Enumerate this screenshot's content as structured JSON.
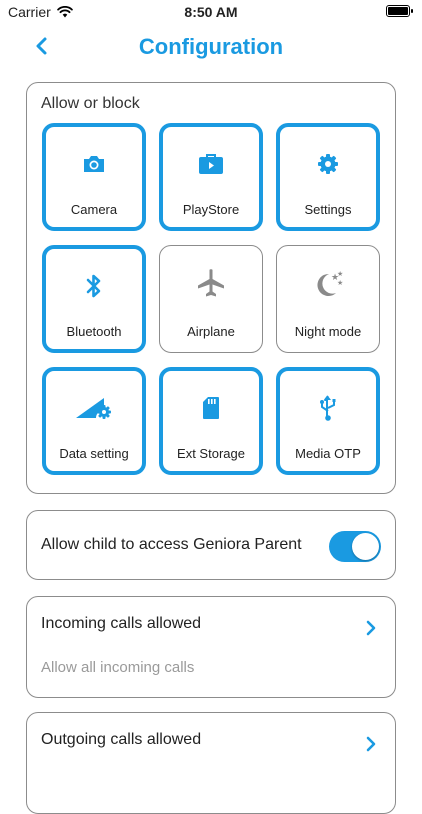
{
  "status_bar": {
    "carrier": "Carrier",
    "time": "8:50 AM",
    "battery_level": 1.0
  },
  "header": {
    "title": "Configuration",
    "back_icon": "chevron-left-icon"
  },
  "allow_block": {
    "label": "Allow or block",
    "tiles": [
      {
        "label": "Camera",
        "icon": "camera-icon",
        "enabled": true
      },
      {
        "label": "PlayStore",
        "icon": "briefcase-icon",
        "enabled": true
      },
      {
        "label": "Settings",
        "icon": "gear-icon",
        "enabled": true
      },
      {
        "label": "Bluetooth",
        "icon": "bluetooth-icon",
        "enabled": true
      },
      {
        "label": "Airplane",
        "icon": "airplane-icon",
        "enabled": false
      },
      {
        "label": "Night mode",
        "icon": "moon-icon",
        "enabled": false
      },
      {
        "label": "Data setting",
        "icon": "signal-gear-icon",
        "enabled": true
      },
      {
        "label": "Ext Storage",
        "icon": "sd-card-icon",
        "enabled": true
      },
      {
        "label": "Media OTP",
        "icon": "usb-icon",
        "enabled": true
      }
    ]
  },
  "parent_access": {
    "label": "Allow child to access Geniora Parent",
    "enabled": true
  },
  "incoming_calls": {
    "title": "Incoming calls allowed",
    "subtitle": "Allow all incoming calls"
  },
  "outgoing_calls": {
    "title": "Outgoing calls allowed"
  },
  "colors": {
    "accent": "#1a9ae1",
    "inactive_icon": "#8a8a8a",
    "border": "#8c8c8c",
    "subtitle": "#9a9a9a"
  }
}
